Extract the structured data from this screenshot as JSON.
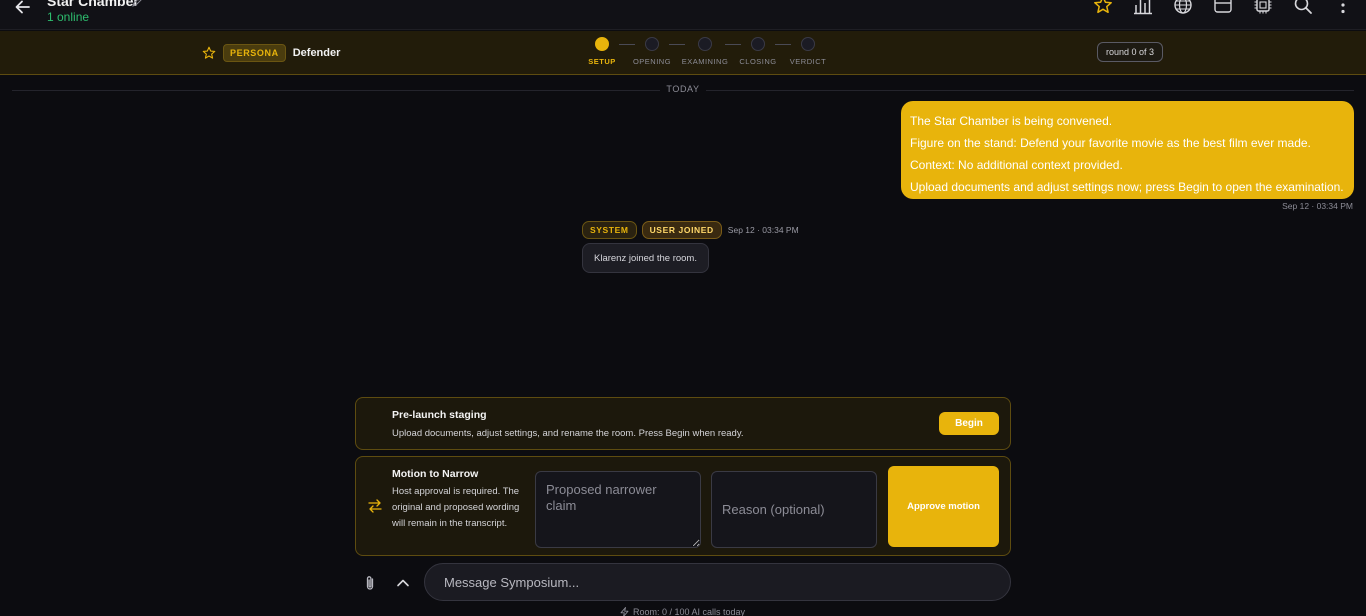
{
  "header": {
    "title": "Star Chamber",
    "online": "1 online"
  },
  "persona": {
    "badge": "PERSONA",
    "name": "Defender"
  },
  "phases": [
    "SETUP",
    "OPENING",
    "EXAMINING",
    "CLOSING",
    "VERDICT"
  ],
  "round": "round 0 of 3",
  "divider": "TODAY",
  "own_message": {
    "lines": [
      "The Star Chamber is being convened.",
      "Figure on the stand: Defend your favorite movie as the best film ever made.",
      "Context: No additional context provided.",
      "Upload documents and adjust settings now; press Begin to open the examination."
    ],
    "time": "Sep 12 · 03:34 PM"
  },
  "system_message": {
    "tag_system": "SYSTEM",
    "tag_event": "USER JOINED",
    "time": "Sep 12 · 03:34 PM",
    "text": "Klarenz joined the room."
  },
  "staging": {
    "title": "Pre-launch staging",
    "description": "Upload documents, adjust settings, and rename the room. Press Begin when ready.",
    "button": "Begin"
  },
  "motion": {
    "title": "Motion to Narrow",
    "description": "Host approval is required. The original and proposed wording will remain in the transcript.",
    "claim_placeholder": "Proposed narrower claim",
    "reason_placeholder": "Reason (optional)",
    "button": "Approve motion"
  },
  "composer": {
    "placeholder": "Message Symposium..."
  },
  "quota": "Room: 0 / 100 AI calls today",
  "colors": {
    "accent": "#e8b40c",
    "online": "#2dbd6e",
    "background": "#0c0c10"
  }
}
